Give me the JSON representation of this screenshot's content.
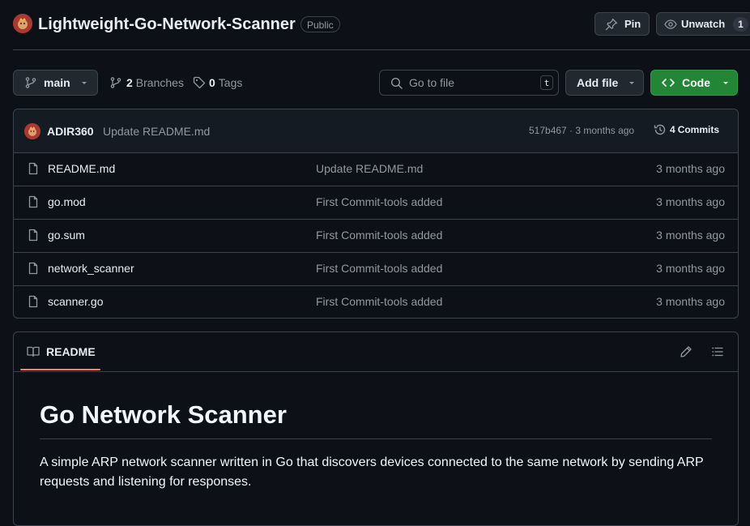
{
  "repo": {
    "name": "Lightweight-Go-Network-Scanner",
    "visibility": "Public"
  },
  "header_actions": {
    "pin_label": "Pin",
    "unwatch_label": "Unwatch",
    "watch_count": "1"
  },
  "branch_bar": {
    "branch_label": "main",
    "branches_count": "2",
    "branches_label": "Branches",
    "tags_count": "0",
    "tags_label": "Tags",
    "search_placeholder": "Go to file",
    "search_shortcut": "t",
    "add_file_label": "Add file",
    "code_label": "Code"
  },
  "latest_commit": {
    "author": "ADIR360",
    "message": "Update README.md",
    "meta": "517b467 · 3 months ago",
    "commits_count": "4",
    "commits_label": "Commits"
  },
  "files": [
    {
      "name": "README.md",
      "message": "Update README.md",
      "date": "3 months ago"
    },
    {
      "name": "go.mod",
      "message": "First Commit-tools added",
      "date": "3 months ago"
    },
    {
      "name": "go.sum",
      "message": "First Commit-tools added",
      "date": "3 months ago"
    },
    {
      "name": "network_scanner",
      "message": "First Commit-tools added",
      "date": "3 months ago"
    },
    {
      "name": "scanner.go",
      "message": "First Commit-tools added",
      "date": "3 months ago"
    }
  ],
  "readme": {
    "tab_label": "README",
    "heading": "Go Network Scanner",
    "paragraph": "A simple ARP network scanner written in Go that discovers devices connected to the same network by sending ARP requests and listening for responses."
  },
  "colors": {
    "background": "#0d1117",
    "border": "#3d444d",
    "code_button": "#238636",
    "tab_accent": "#f78166",
    "muted_text": "#9198a1"
  },
  "icons": [
    "repo-avatar",
    "pin-icon",
    "eye-icon",
    "git-branch-icon",
    "tag-icon",
    "search-icon",
    "chevron-down-icon",
    "code-icon",
    "history-icon",
    "file-icon",
    "book-icon",
    "pencil-icon",
    "list-icon"
  ]
}
